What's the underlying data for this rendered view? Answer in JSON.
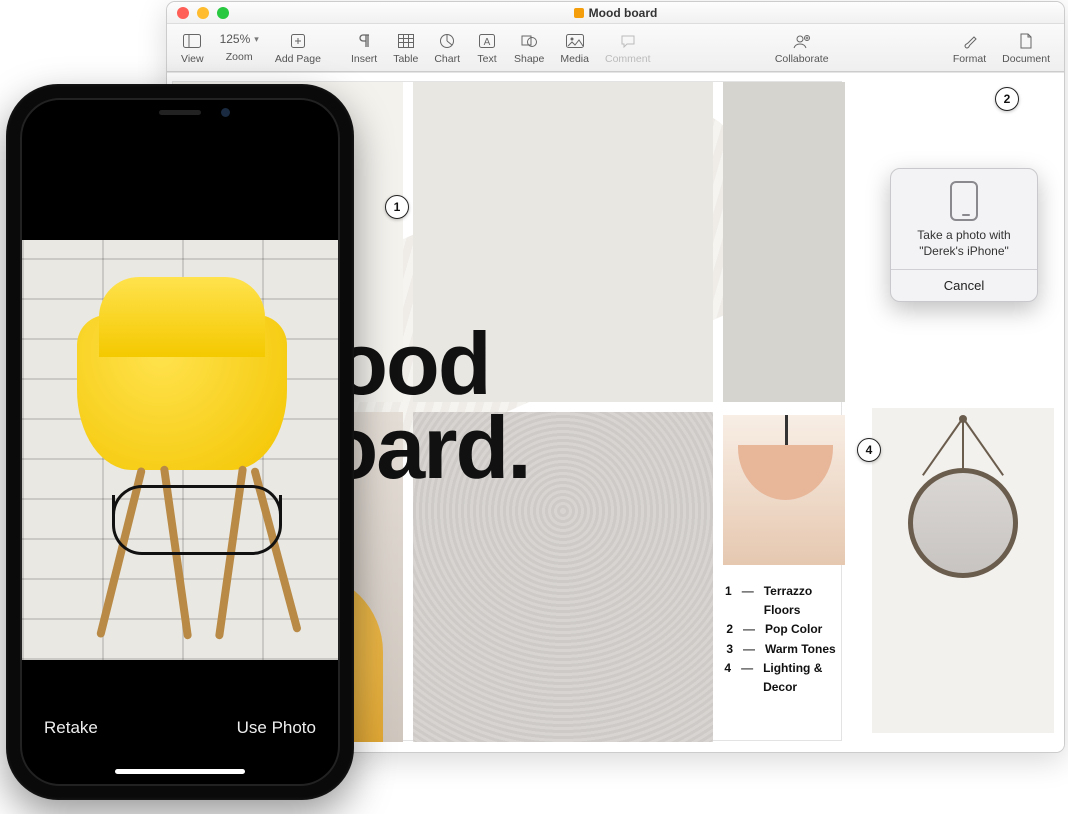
{
  "window": {
    "title": "Mood board"
  },
  "toolbar": {
    "view": "View",
    "zoom_value": "125%",
    "zoom": "Zoom",
    "add_page": "Add Page",
    "insert": "Insert",
    "table": "Table",
    "chart": "Chart",
    "text": "Text",
    "shape": "Shape",
    "media": "Media",
    "comment": "Comment",
    "collaborate": "Collaborate",
    "format": "Format",
    "document": "Document"
  },
  "page": {
    "headline_l1": "Mood",
    "headline_l2": "Board.",
    "marker1": "1",
    "marker2": "2",
    "marker4": "4",
    "legend": [
      {
        "n": "1",
        "label": "Terrazzo Floors"
      },
      {
        "n": "2",
        "label": "Pop Color"
      },
      {
        "n": "3",
        "label": "Warm Tones"
      },
      {
        "n": "4",
        "label": "Lighting & Decor"
      }
    ]
  },
  "popover": {
    "text_l1": "Take a photo with",
    "text_l2": "\"Derek's iPhone\"",
    "cancel": "Cancel"
  },
  "iphone": {
    "retake": "Retake",
    "use_photo": "Use Photo"
  }
}
